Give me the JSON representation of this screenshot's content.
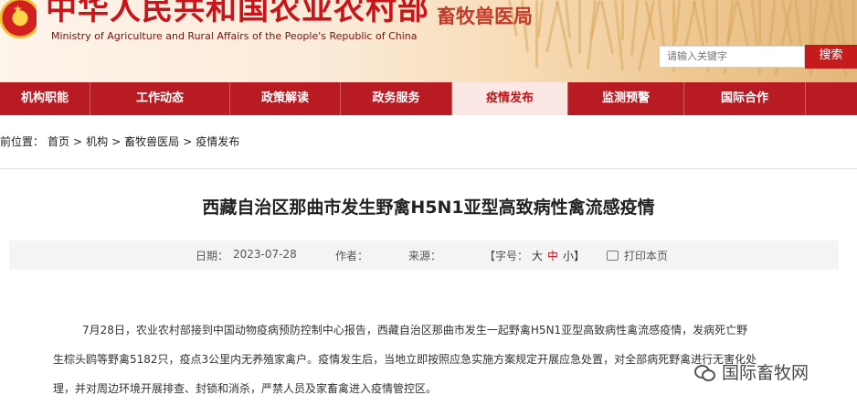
{
  "header": {
    "site_title": "中华人民共和国农业农村部",
    "site_subtitle": "Ministry of Agriculture and Rural Affairs of the People's Republic of China",
    "department": "畜牧兽医局",
    "search_placeholder": "请输入关键字",
    "search_button": "搜索"
  },
  "nav": {
    "items": [
      {
        "label": "机构职能"
      },
      {
        "label": "工作动态"
      },
      {
        "label": "政策解读"
      },
      {
        "label": "政务服务"
      },
      {
        "label": "疫情发布",
        "active": true
      },
      {
        "label": "监测预警"
      },
      {
        "label": "国际合作"
      }
    ]
  },
  "breadcrumb": {
    "prefix": "前位置：",
    "items": [
      "首页",
      "机构",
      "畜牧兽医局",
      "疫情发布"
    ],
    "separator": ">"
  },
  "article": {
    "title": "西藏自治区那曲市发生野禽H5N1亚型高致病性禽流感疫情",
    "meta": {
      "date_label": "日期：",
      "date": "2023-07-28",
      "author_label": "作者：",
      "source_label": "来源：",
      "font_label": "【字号：",
      "font_large": "大",
      "font_medium": "中",
      "font_small": "小】",
      "print": "打印本页"
    },
    "paragraph_lines": [
      "7月28日，农业农村部接到中国动物疫病预防控制中心报告，西藏自治区那曲市发生一起野禽H5N1亚型高致病性禽流感疫情，发病死亡野",
      "生棕头鸥等野禽5182只，疫点3公里内无养殖家禽户。疫情发生后，当地立即按照应急实施方案规定开展应急处置，对全部病死野禽进行无害化处",
      "理，并对周边环境开展排查、封锁和消杀，严禁人员及家畜禽进入疫情管控区。"
    ]
  },
  "watermark": {
    "text": "国际畜牧网",
    "icon": "wechat-icon"
  },
  "colors": {
    "brand_red": "#b81c22",
    "active_tab_bg": "#fbe7e4",
    "title_red": "#c8141a"
  }
}
